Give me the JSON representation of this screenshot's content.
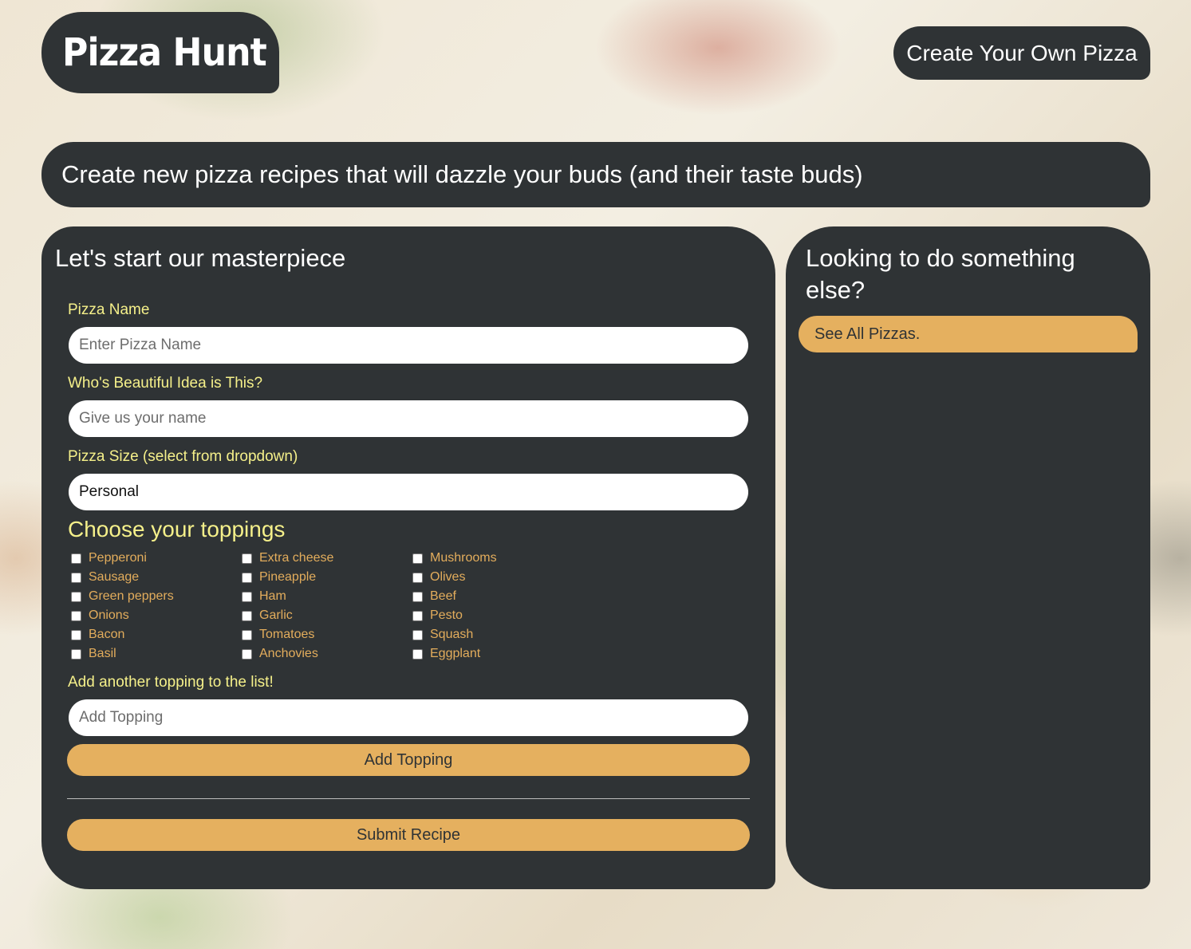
{
  "header": {
    "logo_text": "Pizza Hunt",
    "create_link": "Create Your Own Pizza"
  },
  "tagline": "Create new pizza recipes that will dazzle your buds (and their taste buds)",
  "form": {
    "title": "Let's start our masterpiece",
    "pizza_name_label": "Pizza Name",
    "pizza_name_placeholder": "Enter Pizza Name",
    "author_label": "Who's Beautiful Idea is This?",
    "author_placeholder": "Give us your name",
    "size_label": "Pizza Size (select from dropdown)",
    "size_value": "Personal",
    "toppings_title": "Choose your toppings",
    "toppings": [
      [
        "Pepperoni",
        "Sausage",
        "Green peppers",
        "Onions",
        "Bacon",
        "Basil"
      ],
      [
        "Extra cheese",
        "Pineapple",
        "Ham",
        "Garlic",
        "Tomatoes",
        "Anchovies"
      ],
      [
        "Mushrooms",
        "Olives",
        "Beef",
        "Pesto",
        "Squash",
        "Eggplant"
      ]
    ],
    "add_topping_label": "Add another topping to the list!",
    "add_topping_placeholder": "Add Topping",
    "add_topping_button": "Add Topping",
    "submit_button": "Submit Recipe"
  },
  "side": {
    "title": "Looking to do something else?",
    "see_all_link": "See All Pizzas."
  },
  "colors": {
    "panel": "#2f3335",
    "accent": "#e5b05f",
    "label_yellow": "#f5f08a",
    "topping_orange": "#e3ad5c"
  }
}
